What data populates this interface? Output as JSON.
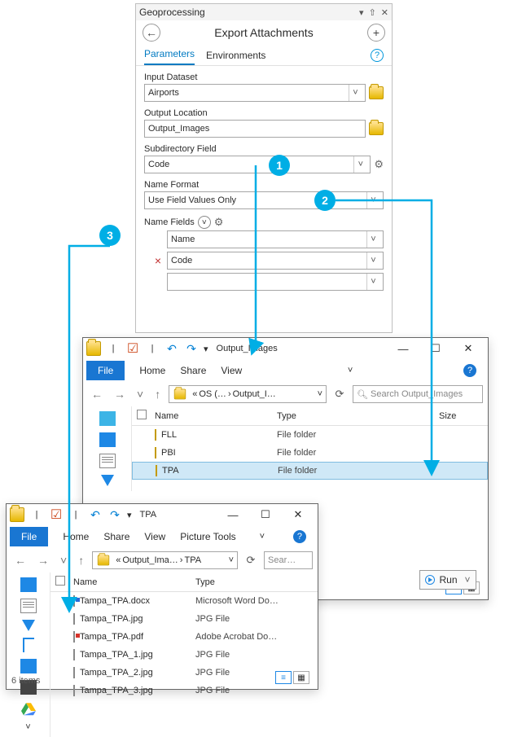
{
  "geoprocessing": {
    "panel_title": "Geoprocessing",
    "tool_title": "Export Attachments",
    "tabs": {
      "parameters": "Parameters",
      "environments": "Environments"
    },
    "fields": {
      "input_dataset": {
        "label": "Input Dataset",
        "value": "Airports"
      },
      "output_location": {
        "label": "Output Location",
        "value": "Output_Images"
      },
      "subdirectory_field": {
        "label": "Subdirectory Field",
        "value": "Code"
      },
      "name_format": {
        "label": "Name Format",
        "value": "Use Field Values Only"
      },
      "name_fields": {
        "label": "Name Fields",
        "rows": [
          "Name",
          "Code"
        ]
      }
    },
    "run_label": "Run"
  },
  "explorer1": {
    "qat_title": "Output_Images",
    "tabs": {
      "file": "File",
      "home": "Home",
      "share": "Share",
      "view": "View"
    },
    "breadcrumb": {
      "prefix": "«",
      "seg1": "OS (…",
      "seg2": "Output_I…"
    },
    "search_placeholder": "Search Output_Images",
    "columns": {
      "name": "Name",
      "type": "Type",
      "size": "Size"
    },
    "rows": [
      {
        "name": "FLL",
        "type": "File folder"
      },
      {
        "name": "PBI",
        "type": "File folder"
      },
      {
        "name": "TPA",
        "type": "File folder"
      }
    ]
  },
  "explorer2": {
    "qat_title": "TPA",
    "tabs": {
      "file": "File",
      "home": "Home",
      "share": "Share",
      "view": "View",
      "picture": "Picture Tools"
    },
    "breadcrumb": {
      "prefix": "«",
      "seg1": "Output_Ima…",
      "seg2": "TPA"
    },
    "search_placeholder": "Sear…",
    "columns": {
      "name": "Name",
      "type": "Type"
    },
    "rows": [
      {
        "name": "Tampa_TPA.docx",
        "type": "Microsoft Word Do…",
        "icon": "blue"
      },
      {
        "name": "Tampa_TPA.jpg",
        "type": "JPG File",
        "icon": "doc"
      },
      {
        "name": "Tampa_TPA.pdf",
        "type": "Adobe Acrobat Do…",
        "icon": "red"
      },
      {
        "name": "Tampa_TPA_1.jpg",
        "type": "JPG File",
        "icon": "doc"
      },
      {
        "name": "Tampa_TPA_2.jpg",
        "type": "JPG File",
        "icon": "doc"
      },
      {
        "name": "Tampa_TPA_3.jpg",
        "type": "JPG File",
        "icon": "doc"
      }
    ],
    "status": "6 items"
  },
  "callouts": {
    "c1": "1",
    "c2": "2",
    "c3": "3"
  }
}
